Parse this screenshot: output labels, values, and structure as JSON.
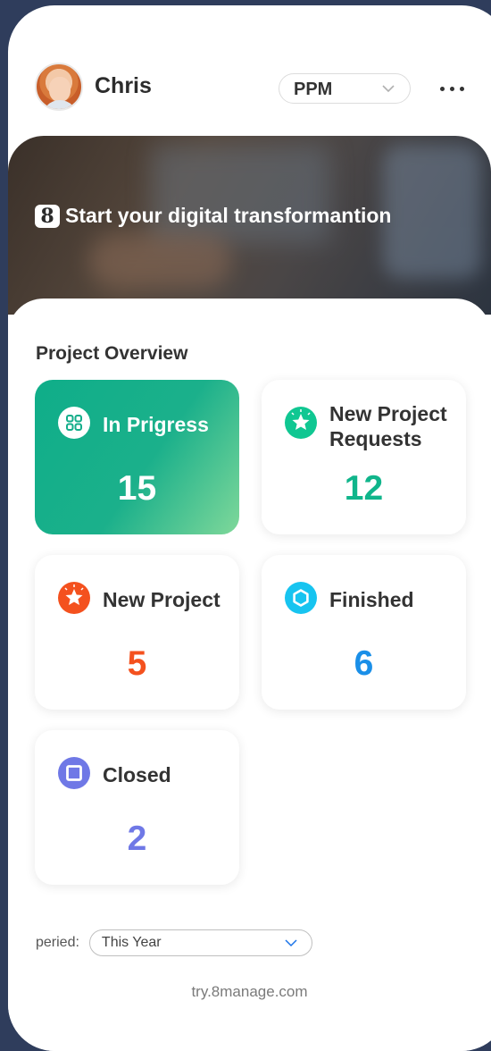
{
  "header": {
    "user_name": "Chris",
    "module": "PPM",
    "more_icon": "more-horizontal-icon"
  },
  "banner": {
    "brand_glyph": "8",
    "title": "Start your digital transformantion"
  },
  "overview": {
    "title": "Project Overview",
    "cards": [
      {
        "label": "In Prigress",
        "count": "15",
        "icon": "apps-grid-icon",
        "color": "#ffffff"
      },
      {
        "label": "New Project Requests",
        "count": "12",
        "icon": "star-badge-icon",
        "color": "#10b58b"
      },
      {
        "label": "New Project",
        "count": "5",
        "icon": "star-badge-icon",
        "color": "#f4511e"
      },
      {
        "label": "Finished",
        "count": "6",
        "icon": "hexagon-icon",
        "color": "#1a8fe8"
      },
      {
        "label": "Closed",
        "count": "2",
        "icon": "square-stop-icon",
        "color": "#6f78e6"
      }
    ]
  },
  "period": {
    "label": "peried:",
    "value": "This Year"
  },
  "footer": {
    "text": "try.8manage.com"
  },
  "colors": {
    "active_card": "#13ad8a",
    "green": "#10b58b",
    "orange": "#f4511e",
    "cyan": "#17c4f0",
    "indigo": "#6f78e6"
  }
}
